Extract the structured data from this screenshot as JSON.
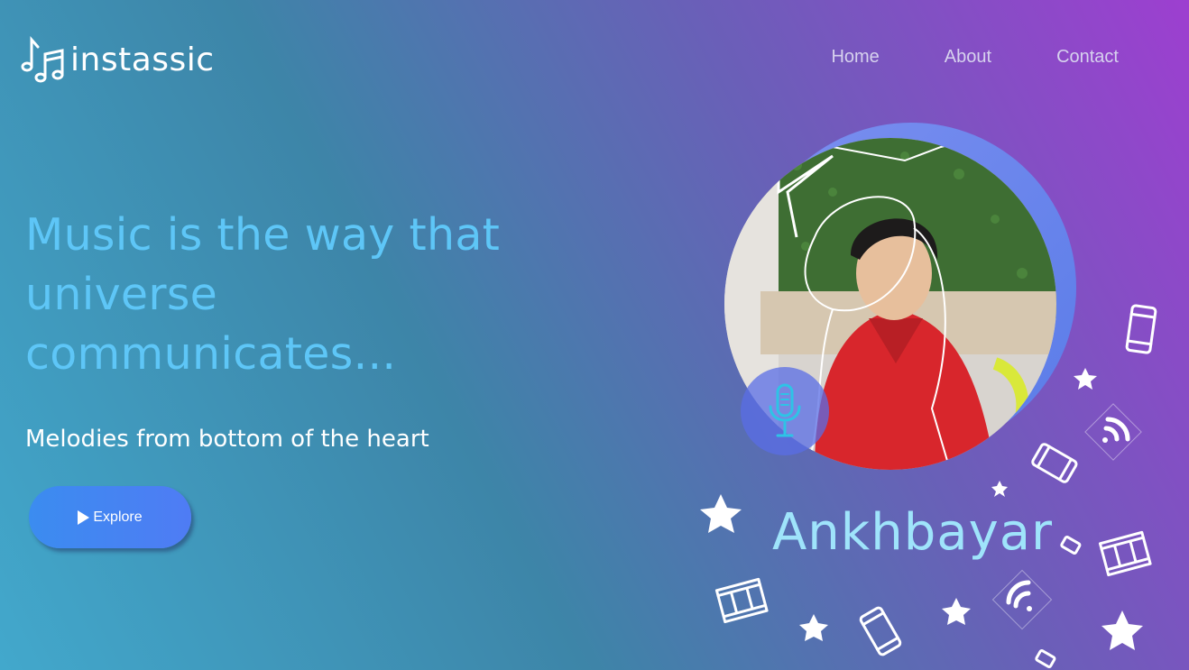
{
  "brand": {
    "logo_icon": "music-notes-icon",
    "name": "instassic"
  },
  "nav": {
    "home": "Home",
    "about": "About",
    "contact": "Contact"
  },
  "hero": {
    "headline": "Music is the way that universe communicates...",
    "subheadline": "Melodies from bottom of the heart",
    "explore_label": "Explore",
    "explore_icon": "play-icon"
  },
  "profile": {
    "name": "Ankhbayar",
    "badge_icon": "microphone-icon"
  },
  "colors": {
    "headline": "#5ec6f7",
    "name": "#9fe4fb",
    "button": "#4a84f2",
    "bg_start": "#42a8cc",
    "bg_end": "#9d3fd0"
  }
}
